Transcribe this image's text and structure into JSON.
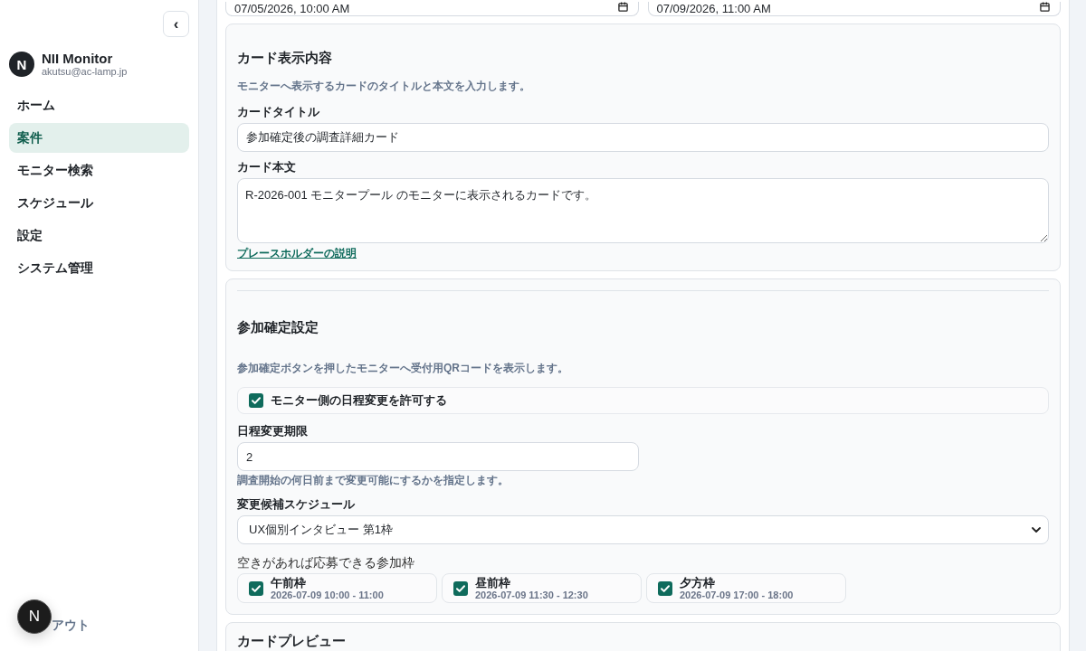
{
  "sidebar": {
    "collapse_button": "‹",
    "user": {
      "avatar": "N",
      "name": "NII Monitor",
      "email": "akutsu@ac-lamp.jp"
    },
    "nav": [
      {
        "label": "ホーム",
        "selected": false
      },
      {
        "label": "案件",
        "selected": true
      },
      {
        "label": "モニター検索",
        "selected": false
      },
      {
        "label": "スケジュール",
        "selected": false
      },
      {
        "label": "設定",
        "selected": false
      },
      {
        "label": "システム管理",
        "selected": false
      }
    ],
    "logout": "アウト"
  },
  "dev_indicator": {
    "letter": "N"
  },
  "schedule_fields": [
    {
      "value": "07/05/2026, 10:00 AM"
    },
    {
      "value": "07/09/2026, 11:00 AM"
    }
  ],
  "card_content": {
    "title": "カード表示内容",
    "description": "モニターへ表示するカードのタイトルと本文を入力します。",
    "title_label": "カードタイトル",
    "title_value": "参加確定後の調査詳細カード",
    "body_label": "カード本文",
    "body_value": "R-2026-001 モニタープール のモニターに表示されるカードです。",
    "help_link": "プレースホルダーの説明"
  },
  "confirmation": {
    "title": "参加確定設定",
    "description": "参加確定ボタンを押したモニターへ受付用QRコードを表示します。",
    "allow_change": {
      "label": "モニター側の日程変更を許可する",
      "checked": true
    },
    "deadline": {
      "label": "日程変更期限",
      "value": "2",
      "hint": "調査開始の何日前まで変更可能にするかを指定します。"
    },
    "schedule": {
      "label": "変更候補スケジュール",
      "value": "UX個別インタビュー 第1枠"
    },
    "slots_label": "空きがあれば応募できる参加枠",
    "slots": [
      {
        "name": "午前枠",
        "time": "2026-07-09 10:00 - 11:00",
        "checked": true
      },
      {
        "name": "昼前枠",
        "time": "2026-07-09 11:30 - 12:30",
        "checked": true
      },
      {
        "name": "夕方枠",
        "time": "2026-07-09 17:00 - 18:00",
        "checked": true
      }
    ]
  },
  "preview": {
    "title": "カードプレビュー"
  }
}
